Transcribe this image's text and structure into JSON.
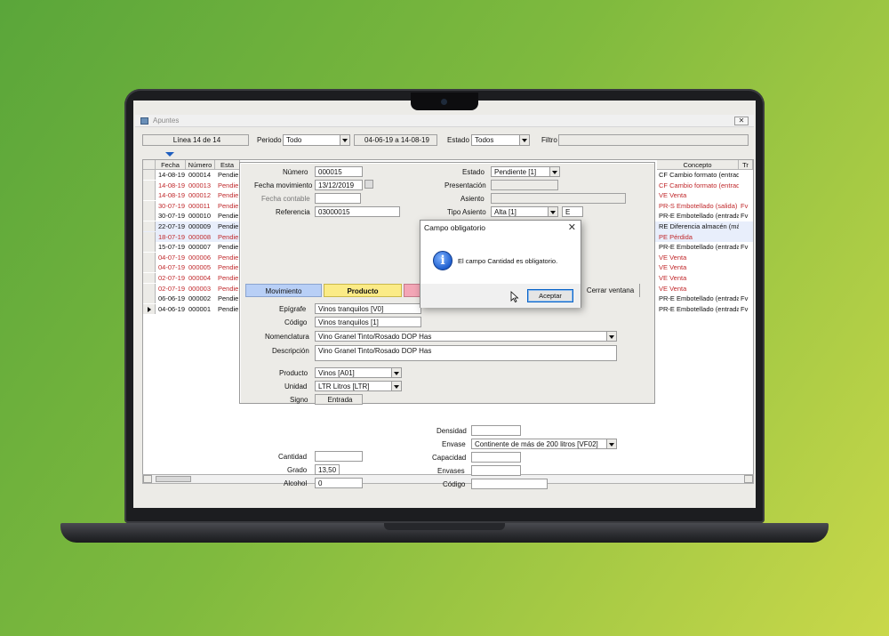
{
  "window": {
    "title": "Apuntes"
  },
  "toolbar": {
    "line_info": "Línea 14 de 14",
    "periodo_label": "Periodo",
    "periodo_value": "Todo",
    "date_range": "04-06-19  a  14-08-19",
    "estado_label": "Estado",
    "estado_value": "Todos",
    "filtro_label": "Filtro",
    "filtro_value": ""
  },
  "grid": {
    "columns": [
      "Fecha",
      "Número",
      "Esta",
      "Concepto",
      "Tr"
    ],
    "rows": [
      {
        "fecha": "14-08-19",
        "numero": "000014",
        "estado": "Pendie",
        "concepto": "CF Cambio formato (entrada",
        "tr": "",
        "red": false
      },
      {
        "fecha": "14-08-19",
        "numero": "000013",
        "estado": "Pendie",
        "concepto": "CF Cambio formato (entrada",
        "tr": "",
        "red": true
      },
      {
        "fecha": "14-08-19",
        "numero": "000012",
        "estado": "Pendie",
        "concepto": "VE Venta",
        "tr": "",
        "red": true
      },
      {
        "fecha": "30-07-19",
        "numero": "000011",
        "estado": "Pendie",
        "concepto": "PR-S Embotellado (salida)",
        "tr": "Fv",
        "red": true
      },
      {
        "fecha": "30-07-19",
        "numero": "000010",
        "estado": "Pendie",
        "concepto": "PR-E Embotellado (entrada",
        "tr": "Fv",
        "red": false
      },
      {
        "fecha": "22-07-19",
        "numero": "000009",
        "estado": "Pendie",
        "concepto": "RE Diferencia almacén (má",
        "tr": "",
        "red": false
      },
      {
        "fecha": "18-07-19",
        "numero": "000008",
        "estado": "Pendie",
        "concepto": "PE Pérdida",
        "tr": "",
        "red": true
      },
      {
        "fecha": "15-07-19",
        "numero": "000007",
        "estado": "Pendie",
        "concepto": "PR-E Embotellado (entrada",
        "tr": "Fv",
        "red": false
      },
      {
        "fecha": "04-07-19",
        "numero": "000006",
        "estado": "Pendie",
        "concepto": "VE Venta",
        "tr": "",
        "red": true
      },
      {
        "fecha": "04-07-19",
        "numero": "000005",
        "estado": "Pendie",
        "concepto": "VE Venta",
        "tr": "",
        "red": true
      },
      {
        "fecha": "02-07-19",
        "numero": "000004",
        "estado": "Pendie",
        "concepto": "VE Venta",
        "tr": "",
        "red": true
      },
      {
        "fecha": "02-07-19",
        "numero": "000003",
        "estado": "Pendie",
        "concepto": "VE Venta",
        "tr": "",
        "red": true
      },
      {
        "fecha": "06-06-19",
        "numero": "000002",
        "estado": "Pendie",
        "concepto": "PR-E Embotellado (entrada",
        "tr": "Fv",
        "red": false
      },
      {
        "fecha": "04-06-19",
        "numero": "000001",
        "estado": "Pendie",
        "concepto": "PR-E Embotellado (entrada",
        "tr": "Fv",
        "red": false
      }
    ]
  },
  "form": {
    "numero_label": "Número",
    "numero_value": "000015",
    "fecha_mov_label": "Fecha movimiento",
    "fecha_mov_value": "13/12/2019",
    "fecha_contable_label": "Fecha contable",
    "fecha_contable_value": "",
    "referencia_label": "Referencia",
    "referencia_value": "03000015",
    "estado_label": "Estado",
    "estado_value": "Pendiente [1]",
    "presentacion_label": "Presentación",
    "presentacion_value": "",
    "asiento_label": "Asiento",
    "asiento_value": "",
    "tipo_asiento_label": "Tipo Asiento",
    "tipo_asiento_value": "Alta [1]",
    "tipo_asiento_code": "E",
    "tabs": [
      "Movimiento",
      "Producto",
      "",
      "Cerrar ventana"
    ],
    "epigrafe_label": "Epígrafe",
    "epigrafe_value": "Vinos tranquilos [V0]",
    "codigo_label": "Código",
    "codigo_value": "Vinos tranquilos [1]",
    "nomenclatura_label": "Nomenclatura",
    "nomenclatura_value": "Vino Granel Tinto/Rosado DOP Has",
    "descripcion_label": "Descripción",
    "descripcion_value": "Vino Granel Tinto/Rosado DOP Has",
    "producto_label": "Producto",
    "producto_value": "Vinos [A01]",
    "unidad_label": "Unidad",
    "unidad_value": "LTR Litros [LTR]",
    "signo_label": "Signo",
    "signo_value": "Entrada",
    "cantidad_label": "Cantidad",
    "cantidad_value": "",
    "grado_label": "Grado",
    "grado_value": "13,50",
    "alcohol_label": "Alcohol",
    "alcohol_value": "0",
    "densidad_label": "Densidad",
    "densidad_value": "",
    "envase_label": "Envase",
    "envase_value": "Continente de más de 200 litros [VF02]",
    "capacidad_label": "Capacidad",
    "capacidad_value": "",
    "envases_label": "Envases",
    "envases_value": "",
    "codigo2_label": "Código",
    "codigo2_value": ""
  },
  "dialog": {
    "title": "Campo obligatorio",
    "message": "El campo Cantidad es obligatorio.",
    "button": "Aceptar"
  }
}
